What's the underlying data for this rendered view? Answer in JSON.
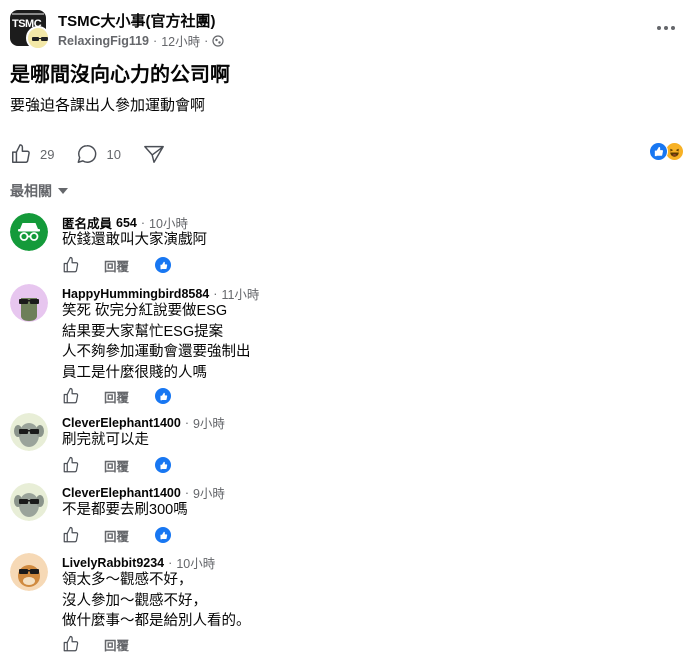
{
  "post": {
    "group_name": "TSMC大小事(官方社團)",
    "author": "RelaxingFig119",
    "dot": "·",
    "time": "12小時",
    "title": "是哪間沒向心力的公司啊",
    "body": "要強迫各課出人參加運動會啊",
    "like_count": "29",
    "comment_count": "10",
    "group_logo_text": "TSMC"
  },
  "sort": {
    "label": "最相關"
  },
  "comments": [
    {
      "name": "匿名成員",
      "badge": "654",
      "dot": "·",
      "time": "10小時",
      "text": "砍錢還敢叫大家演戲阿",
      "reply": "回覆"
    },
    {
      "name": "HappyHummingbird8584",
      "dot": "·",
      "time": "11小時",
      "text": "笑死 砍完分紅說要做ESG\n結果要大家幫忙ESG提案\n人不夠參加運動會還要強制出\n員工是什麼很賤的人嗎",
      "reply": "回覆"
    },
    {
      "name": "CleverElephant1400",
      "dot": "·",
      "time": "9小時",
      "text": "刷完就可以走",
      "reply": "回覆"
    },
    {
      "name": "CleverElephant1400",
      "dot": "·",
      "time": "9小時",
      "text": "不是都要去刷300嗎",
      "reply": "回覆"
    },
    {
      "name": "LivelyRabbit9234",
      "dot": "·",
      "time": "10小時",
      "text": "領太多～觀感不好，\n沒人參加～觀感不好，\n做什麼事～都是給別人看的。",
      "reply": "回覆"
    }
  ],
  "colors": {
    "accent": "#1877f2",
    "secondary_text": "#65676b",
    "primary_text": "#050505",
    "haha": "#f7b125"
  },
  "icons": [
    "more-icon",
    "globe-icon",
    "like-icon",
    "comment-icon",
    "share-icon",
    "like-reaction-icon",
    "haha-reaction-icon",
    "chevron-down-icon"
  ]
}
